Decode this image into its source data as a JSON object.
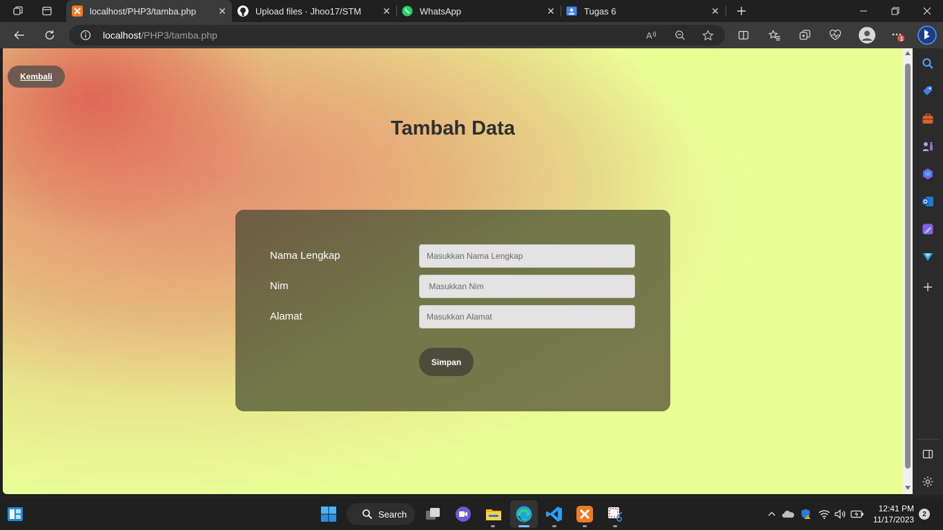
{
  "browser": {
    "tabs": [
      {
        "title": "localhost/PHP3/tamba.php",
        "icon": "xampp-favicon"
      },
      {
        "title": "Upload files · Jhoo17/STM",
        "icon": "github-favicon"
      },
      {
        "title": "WhatsApp",
        "icon": "whatsapp-favicon"
      },
      {
        "title": "Tugas 6",
        "icon": "classroom-favicon"
      }
    ],
    "address": {
      "host": "localhost",
      "path": "/PHP3/tamba.php"
    },
    "badge_count": "1"
  },
  "page": {
    "back_label": "Kembali",
    "title": "Tambah Data",
    "form": {
      "fields": [
        {
          "label": "Nama Lengkap",
          "placeholder": "Masukkan Nama Lengkap",
          "value": ""
        },
        {
          "label": "Nim",
          "placeholder": " Masukkan Nim",
          "value": ""
        },
        {
          "label": "Alamat",
          "placeholder": "Masukkan Alamat",
          "value": ""
        }
      ],
      "submit_label": "Simpan"
    },
    "colors": {
      "card": "#727449",
      "button": "#4d4b3c",
      "back_button": "#6f5a50",
      "background": "#e9ff96",
      "title": "#2f2f2f"
    }
  },
  "taskbar": {
    "search_label": "Search",
    "time": "12:41 PM",
    "date": "11/17/2023",
    "notifications": "2"
  }
}
